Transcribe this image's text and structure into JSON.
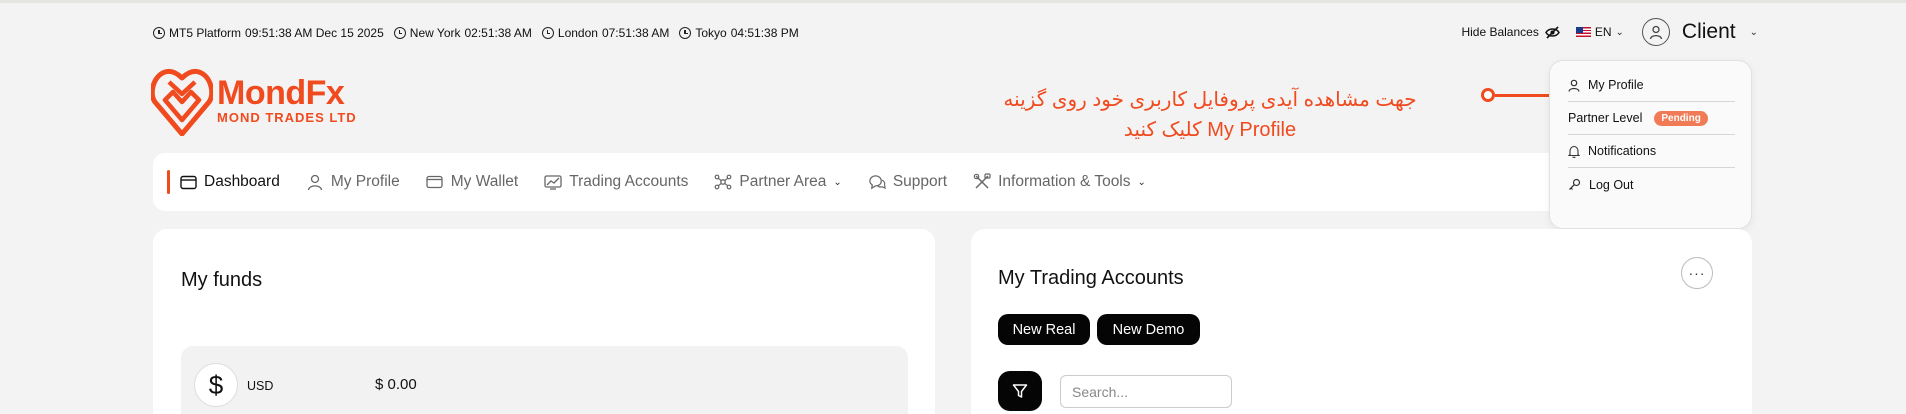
{
  "top_bar": {
    "clocks": [
      {
        "label": "MT5 Platform",
        "time": "09:51:38 AM Dec 15 2025"
      },
      {
        "label": "New York",
        "time": "02:51:38 AM"
      },
      {
        "label": "London",
        "time": "07:51:38 AM"
      },
      {
        "label": "Tokyo",
        "time": "04:51:38 PM"
      }
    ],
    "hide_balances": "Hide Balances",
    "language": "EN",
    "user": "Client"
  },
  "logo": {
    "name": "MondFx",
    "subtitle": "MOND TRADES LTD"
  },
  "annotation": {
    "line1": "جهت مشاهده آیدی پروفایل کاربری خود روی گزینه",
    "line2": "My Profile کلیک کنید"
  },
  "nav": {
    "items": [
      {
        "label": "Dashboard",
        "icon": "dashboard-icon"
      },
      {
        "label": "My Profile",
        "icon": "user-icon"
      },
      {
        "label": "My Wallet",
        "icon": "wallet-icon"
      },
      {
        "label": "Trading Accounts",
        "icon": "chart-icon"
      },
      {
        "label": "Partner Area",
        "icon": "network-icon"
      },
      {
        "label": "Support",
        "icon": "chat-icon"
      },
      {
        "label": "Information & Tools",
        "icon": "tools-icon"
      }
    ]
  },
  "dropdown": {
    "my_profile": "My Profile",
    "partner_level": "Partner Level",
    "partner_status": "Pending",
    "notifications": "Notifications",
    "log_out": "Log Out"
  },
  "funds": {
    "title": "My funds",
    "currency_symbol": "$",
    "currency": "USD",
    "balance": "$ 0.00"
  },
  "trading": {
    "title": "My Trading Accounts",
    "more": "···",
    "new_real": "New Real",
    "new_demo": "New Demo",
    "search_placeholder": "Search..."
  },
  "colors": {
    "accent": "#f04a1e",
    "badge": "#f07b56",
    "button_dark": "#050505"
  }
}
